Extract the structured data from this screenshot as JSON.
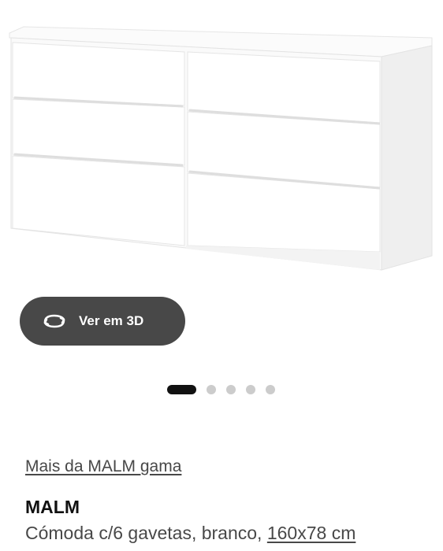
{
  "product": {
    "image_alt_icon": "chest-of-drawers-image",
    "view_3d_label": "Ver em 3D",
    "view_3d_icon": "rotate-3d-icon",
    "carousel": {
      "count": 5,
      "active_index": 0
    },
    "range_link": "Mais da MALM gama",
    "name": "MALM",
    "description": "Cómoda c/6 gavetas, branco, ",
    "dimensions": "160x78 cm"
  },
  "colors": {
    "button_bg": "#484848",
    "active_dot": "#111111",
    "inactive_dot": "#cccccc"
  }
}
